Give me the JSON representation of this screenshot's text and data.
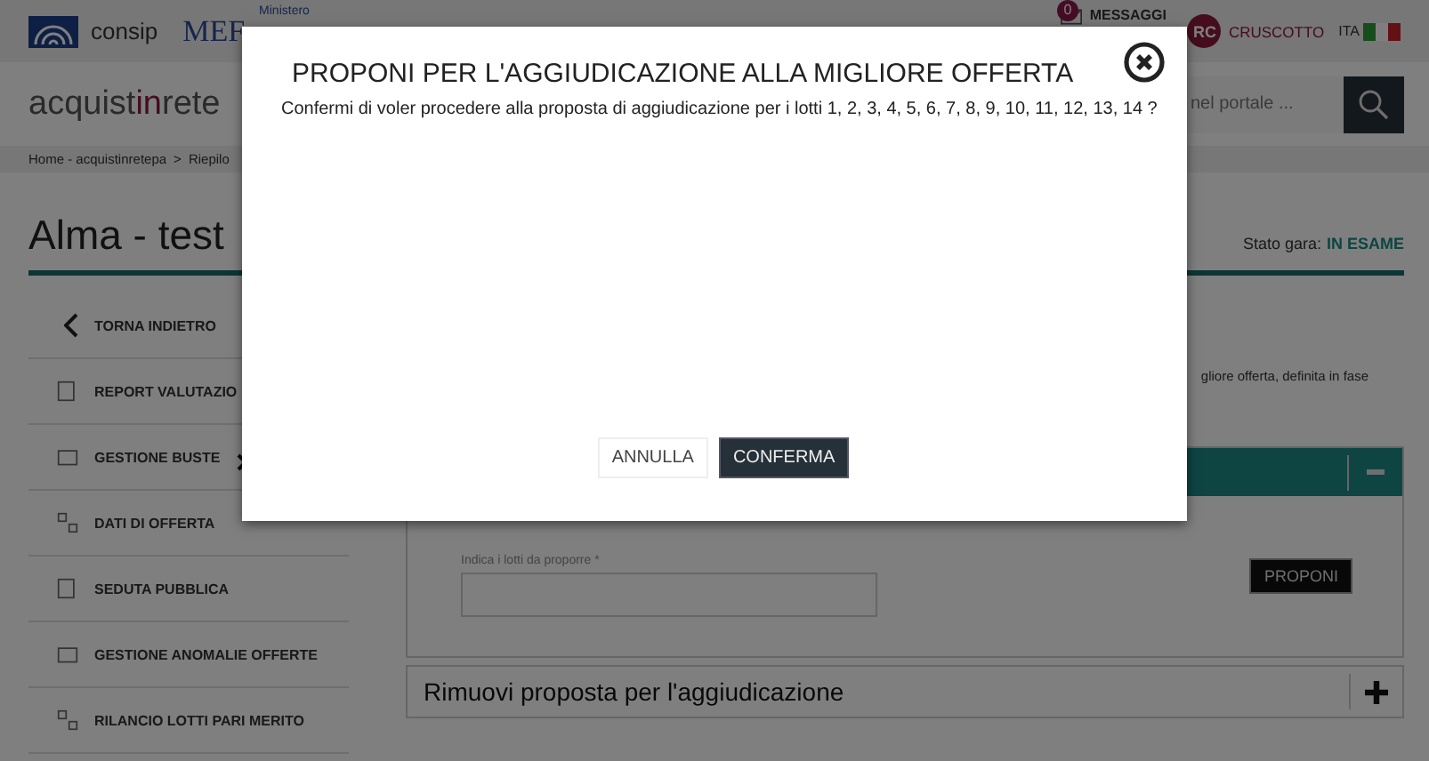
{
  "header": {
    "consip": "consip",
    "mef": "MEF",
    "ministry": "Ministero",
    "messages": {
      "count": "0",
      "label": "MESSAGGI"
    },
    "user": {
      "initials": "RC",
      "label": "CRUSCOTTO"
    },
    "language": "ITA"
  },
  "site": {
    "logo": [
      {
        "text": "acquist",
        "accent": false
      },
      {
        "text": "in",
        "accent": true
      },
      {
        "text": "rete",
        "accent": false
      }
    ],
    "search": {
      "placeholder": "nel portale ..."
    }
  },
  "breadcrumb": {
    "items": [
      "Home - acquistinretepa",
      "Riepilo"
    ],
    "separator": ">"
  },
  "page": {
    "title": "Alma - test",
    "status_label": "Stato gara:",
    "status_value": "IN ESAME"
  },
  "sidebar": {
    "items": [
      {
        "kind": "back",
        "label": "TORNA INDIETRO",
        "has_submenu": false
      },
      {
        "kind": "link",
        "label": "REPORT VALUTAZIO",
        "has_submenu": false
      },
      {
        "kind": "link",
        "label": "GESTIONE BUSTE",
        "has_submenu": true
      },
      {
        "kind": "link",
        "label": "DATI DI OFFERTA",
        "has_submenu": false
      },
      {
        "kind": "link",
        "label": "SEDUTA PUBBLICA",
        "has_submenu": false
      },
      {
        "kind": "link",
        "label": "GESTIONE ANOMALIE OFFERTE",
        "has_submenu": false
      },
      {
        "kind": "link",
        "label": "RILANCIO LOTTI PARI MERITO",
        "has_submenu": false
      }
    ]
  },
  "content": {
    "note": "gliore offerta, definita in fase",
    "panels": [
      {
        "expanded": true,
        "field_label": "Indica i lotti da proporre *",
        "button": "PROPONI"
      },
      {
        "title": "Rimuovi proposta per l'aggiudicazione",
        "expanded": false
      }
    ]
  },
  "modal": {
    "title": "PROPONI PER L'AGGIUDICAZIONE ALLA MIGLIORE OFFERTA",
    "message": "Confermi di voler procedere alla proposta di aggiudicazione per i lotti 1, 2, 3, 4, 5, 6, 7, 8, 9, 10, 11, 12, 13, 14 ?",
    "buttons": [
      {
        "label": "ANNULLA",
        "primary": false
      },
      {
        "label": "CONFERMA",
        "primary": true
      }
    ]
  }
}
